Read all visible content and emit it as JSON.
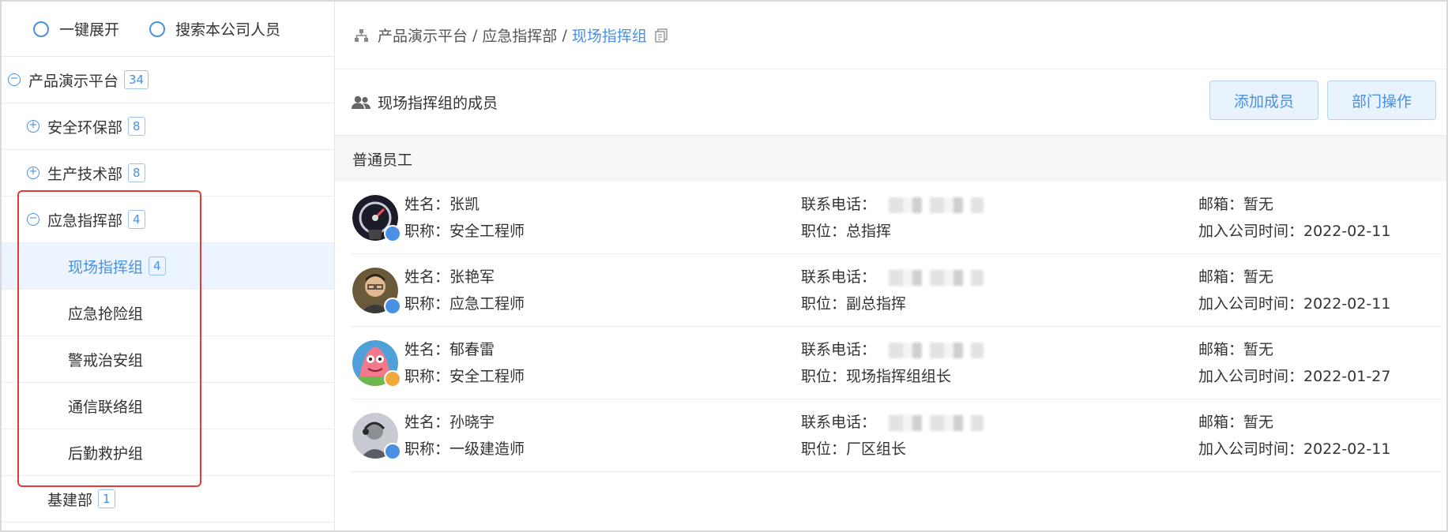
{
  "sidebar": {
    "options": [
      {
        "label": "一键展开"
      },
      {
        "label": "搜索本公司人员"
      }
    ],
    "tree": [
      {
        "label": "产品演示平台",
        "count": "34",
        "toggle": "−"
      },
      {
        "label": "安全环保部",
        "count": "8",
        "toggle": "+"
      },
      {
        "label": "生产技术部",
        "count": "8",
        "toggle": "+"
      },
      {
        "label": "应急指挥部",
        "count": "4",
        "toggle": "−"
      },
      {
        "label": "现场指挥组",
        "count": "4"
      },
      {
        "label": "应急抢险组"
      },
      {
        "label": "警戒治安组"
      },
      {
        "label": "通信联络组"
      },
      {
        "label": "后勤救护组"
      },
      {
        "label": "基建部",
        "count": "1"
      }
    ]
  },
  "breadcrumb": {
    "parts": [
      "产品演示平台",
      "应急指挥部"
    ],
    "separator": "/",
    "current": "现场指挥组"
  },
  "members": {
    "title": "现场指挥组的成员",
    "add_button": "添加成员",
    "ops_button": "部门操作",
    "section": "普通员工",
    "list": [
      {
        "name": "姓名：张凯",
        "title": "职称：安全工程师",
        "phone": "联系电话：",
        "position": "职位：总指挥",
        "email": "邮箱：暂无",
        "joined": "加入公司时间：2022-02-11"
      },
      {
        "name": "姓名：张艳军",
        "title": "职称：应急工程师",
        "phone": "联系电话：",
        "position": "职位：副总指挥",
        "email": "邮箱：暂无",
        "joined": "加入公司时间：2022-02-11"
      },
      {
        "name": "姓名：郁春雷",
        "title": "职称：安全工程师",
        "phone": "联系电话：",
        "position": "职位：现场指挥组组长",
        "email": "邮箱：暂无",
        "joined": "加入公司时间：2022-01-27"
      },
      {
        "name": "姓名：孙晓宇",
        "title": "职称：一级建造师",
        "phone": "联系电话：",
        "position": "职位：厂区组长",
        "email": "邮箱：暂无",
        "joined": "加入公司时间：2022-02-11"
      }
    ]
  },
  "colors": {
    "accent": "#4a90e2",
    "highlight_box": "#e53935",
    "selected_bg": "#ecf5ff"
  }
}
